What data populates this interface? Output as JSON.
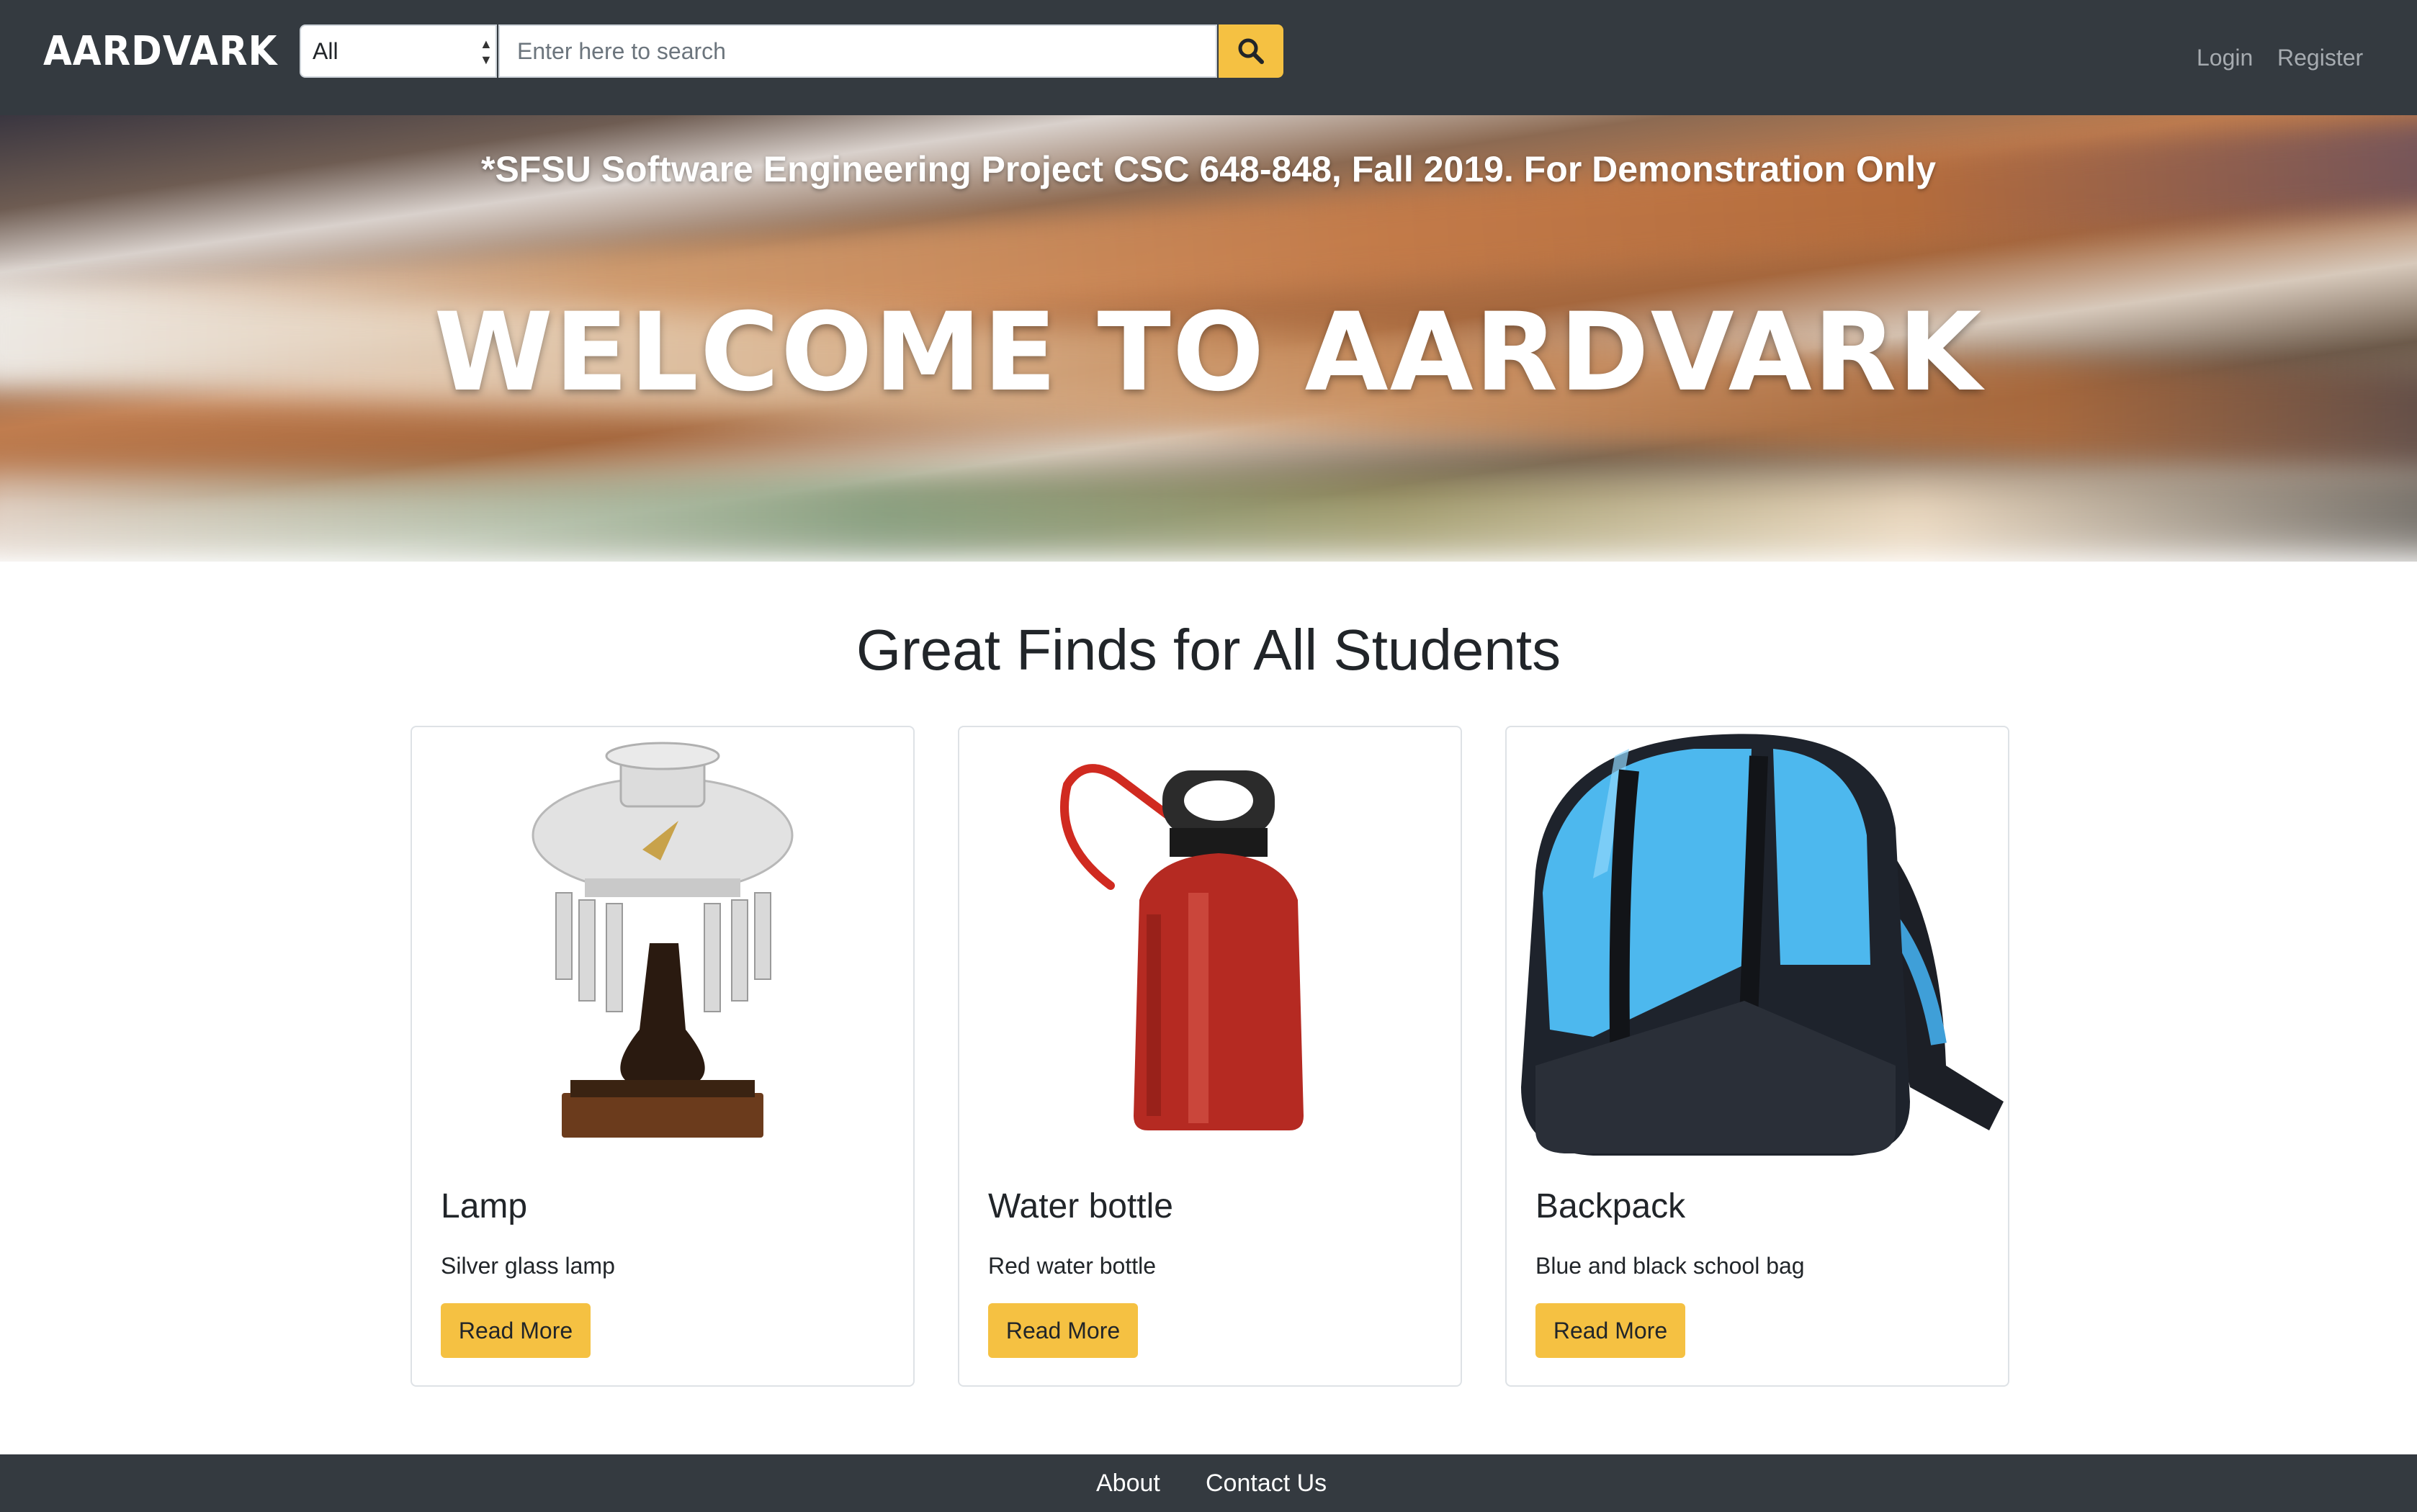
{
  "nav": {
    "brand": "AARDVARK",
    "category_selected": "All",
    "search_placeholder": "Enter here to search",
    "login": "Login",
    "register": "Register"
  },
  "hero": {
    "notice": "*SFSU Software Engineering Project CSC 648-848, Fall 2019. For Demonstration Only",
    "title": "WELCOME TO AARDVARK"
  },
  "main": {
    "section_title": "Great Finds for All Students",
    "cards": [
      {
        "title": "Lamp",
        "text": "Silver glass lamp",
        "button": "Read More"
      },
      {
        "title": "Water bottle",
        "text": "Red water bottle",
        "button": "Read More"
      },
      {
        "title": "Backpack",
        "text": "Blue and black school bag",
        "button": "Read More"
      }
    ]
  },
  "footer": {
    "about": "About",
    "contact": "Contact Us"
  },
  "colors": {
    "navbar": "#343a40",
    "accent": "#f5c142",
    "nav_link": "#a6abb0"
  }
}
